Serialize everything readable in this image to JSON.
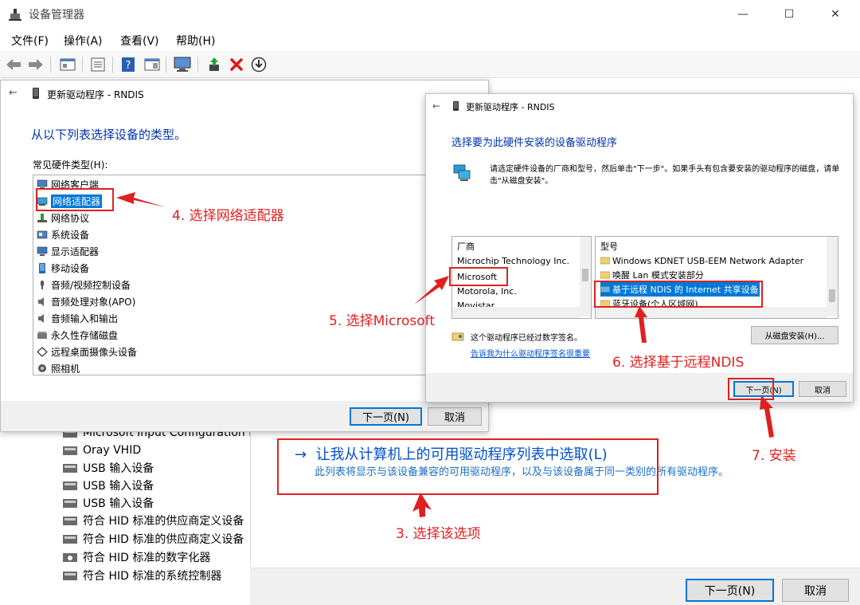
{
  "window": {
    "title": "设备管理器",
    "minimize": "—",
    "maximize": "☐",
    "close": "✕"
  },
  "menu": {
    "items": [
      "文件(F)",
      "操作(A)",
      "查看(V)",
      "帮助(H)"
    ]
  },
  "toolbar": {
    "icons": [
      "back-icon",
      "forward-icon",
      "properties-icon",
      "list-icon",
      "help-icon",
      "detail-icon",
      "monitor-scan-icon",
      "update-driver-icon",
      "uninstall-icon",
      "download-icon"
    ]
  },
  "device_tree": {
    "items": [
      "Microsoft Input Configuration D",
      "Oray VHID",
      "USB 输入设备",
      "USB 输入设备",
      "USB 输入设备",
      "符合 HID 标准的供应商定义设备",
      "符合 HID 标准的供应商定义设备",
      "符合 HID 标准的数字化器",
      "符合 HID 标准的系统控制器"
    ]
  },
  "wizard_back": {
    "option_arrow": "→",
    "option_title": "让我从计算机上的可用驱动程序列表中选取(L)",
    "option_desc": "此列表将显示与该设备兼容的可用驱动程序，以及与该设备属于同一类别的所有驱动程序。",
    "next_button": "下一页(N)",
    "cancel_button": "取消"
  },
  "dialog_hw": {
    "back_arrow": "←",
    "title": "更新驱动程序 - RNDIS",
    "heading": "从以下列表选择设备的类型。",
    "list_label": "常见硬件类型(H):",
    "items": [
      "网络客户端",
      "网络适配器",
      "网络协议",
      "系统设备",
      "显示适配器",
      "移动设备",
      "音频/视频控制设备",
      "音频处理对象(APO)",
      "音频输入和输出",
      "永久性存储磁盘",
      "远程桌面摄像头设备",
      "照相机"
    ],
    "selected_index": 1,
    "next_button": "下一页(N)",
    "cancel_button": "取消"
  },
  "dialog_driver": {
    "back_arrow": "←",
    "title": "更新驱动程序 - RNDIS",
    "heading": "选择要为此硬件安装的设备驱动程序",
    "instruction": "请选定硬件设备的厂商和型号，然后单击\"下一步\"。如果手头有包含要安装的驱动程序的磁盘，请单击\"从磁盘安装\"。",
    "manufacturer_header": "厂商",
    "manufacturers": [
      "Microchip Technology Inc.",
      "Microsoft",
      "Motorola, Inc.",
      "Movistar"
    ],
    "model_header": "型号",
    "models": [
      "Windows KDNET USB-EEM Network Adapter",
      "唤醒 Lan 模式安装部分",
      "基于远程 NDIS 的 Internet 共享设备",
      "蓝牙设备(个人区域网)"
    ],
    "selected_model_index": 2,
    "signed_text": "这个驱动程序已经过数字签名。",
    "signing_link": "告诉我为什么驱动程序签名很重要",
    "disk_button": "从磁盘安装(H)...",
    "next_button": "下一页(N)",
    "cancel_button": "取消"
  },
  "annotations": {
    "step3": "3. 选择该选项",
    "step4": "4. 选择网络适配器",
    "step5": "5. 选择Microsoft",
    "step6": "6. 选择基于远程NDIS",
    "step7": "7. 安装",
    "color": "#e02020"
  },
  "colors": {
    "accent": "#0078d7",
    "link": "#0050c8",
    "annotation": "#e02020"
  }
}
